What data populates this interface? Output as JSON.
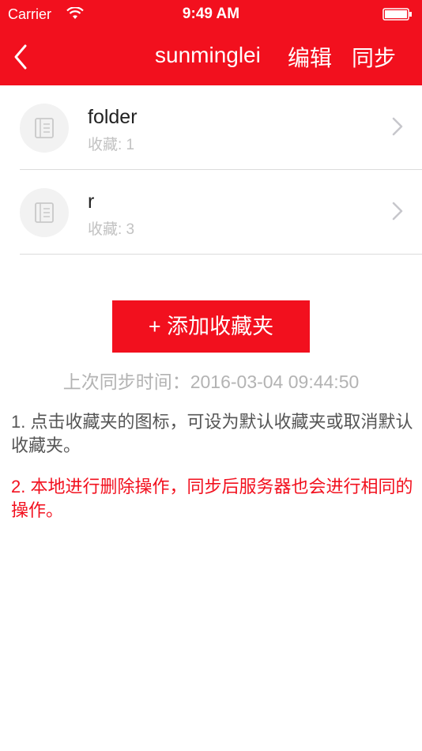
{
  "status_bar": {
    "carrier": "Carrier",
    "time": "9:49 AM"
  },
  "nav": {
    "title": "sunminglei",
    "edit": "编辑",
    "sync": "同步"
  },
  "folders": [
    {
      "name": "folder",
      "count": "收藏: 1"
    },
    {
      "name": "r",
      "count": "收藏: 3"
    }
  ],
  "add_button": "+ 添加收藏夹",
  "last_sync": "上次同步时间：2016-03-04 09:44:50",
  "tips": [
    "1. 点击收藏夹的图标，可设为默认收藏夹或取消默认收藏夹。",
    "2. 本地进行删除操作，同步后服务器也会进行相同的操作。"
  ],
  "colors": {
    "brand": "#f2101e",
    "muted": "#b3b3b3"
  }
}
